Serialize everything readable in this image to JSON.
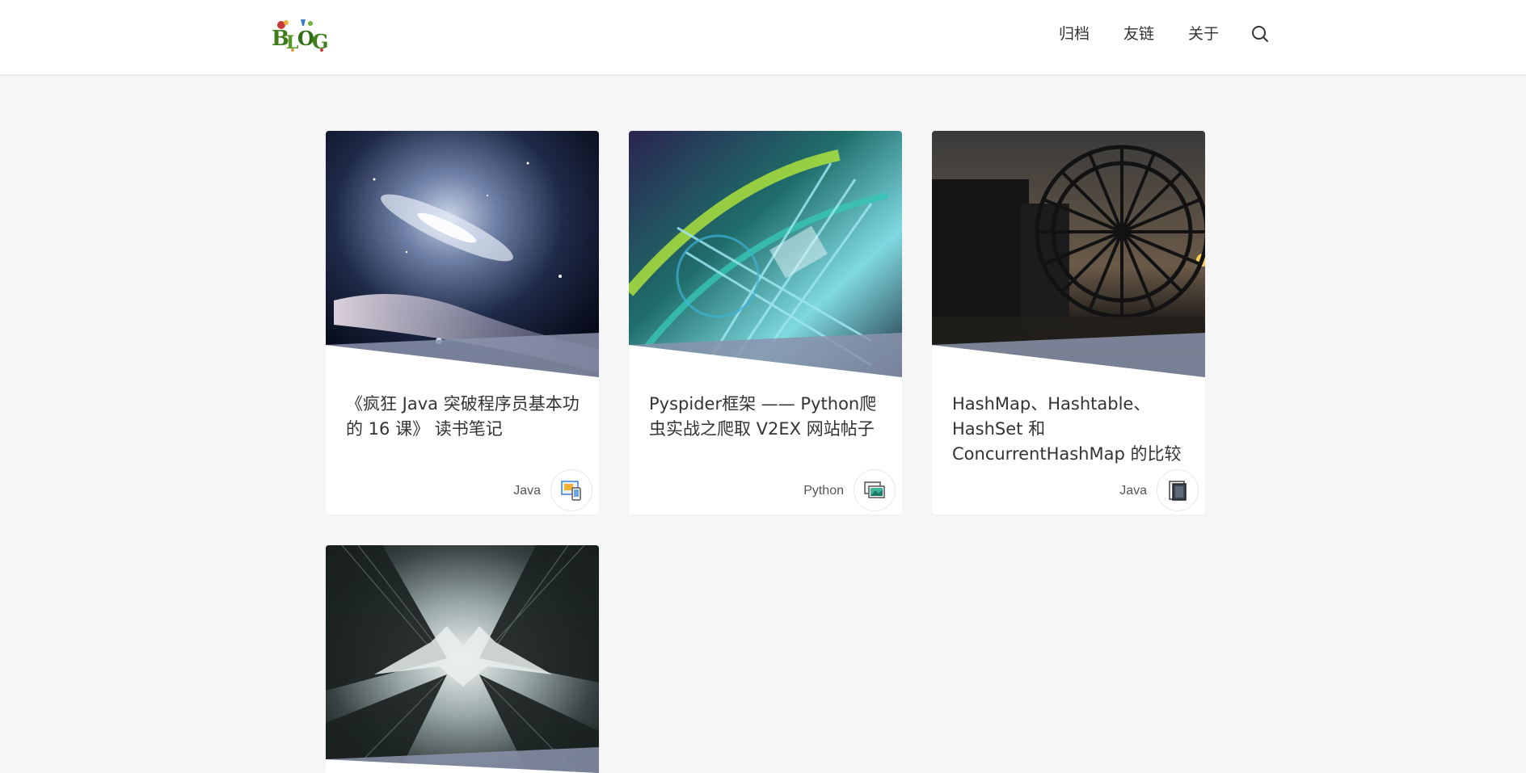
{
  "header": {
    "logo_text": "BLOG",
    "nav": [
      "归档",
      "友链",
      "关于"
    ]
  },
  "cards": [
    {
      "title": "《疯狂 Java 突破程序员基本功的 16 课》 读书笔记",
      "category": "Java",
      "cover_icon": "galaxy-cover-image",
      "badge_icon": "image-device-icon"
    },
    {
      "title": "Pyspider框架 —— Python爬虫实战之爬取 V2EX 网站帖子",
      "category": "Python",
      "cover_icon": "abstract-tech-cover-image",
      "badge_icon": "image-gallery-icon"
    },
    {
      "title": "HashMap、Hashtable、HashSet 和 ConcurrentHashMap 的比较",
      "category": "Java",
      "cover_icon": "waterwheel-cover-image",
      "badge_icon": "document-stack-icon"
    },
    {
      "title": "",
      "category": "",
      "cover_icon": "city-bat-cover-image",
      "badge_icon": ""
    }
  ],
  "colors": {
    "page_bg": "#f6f6f6",
    "card_bg": "#ffffff",
    "text": "#333333",
    "logo_green": "#3e7d1a"
  }
}
